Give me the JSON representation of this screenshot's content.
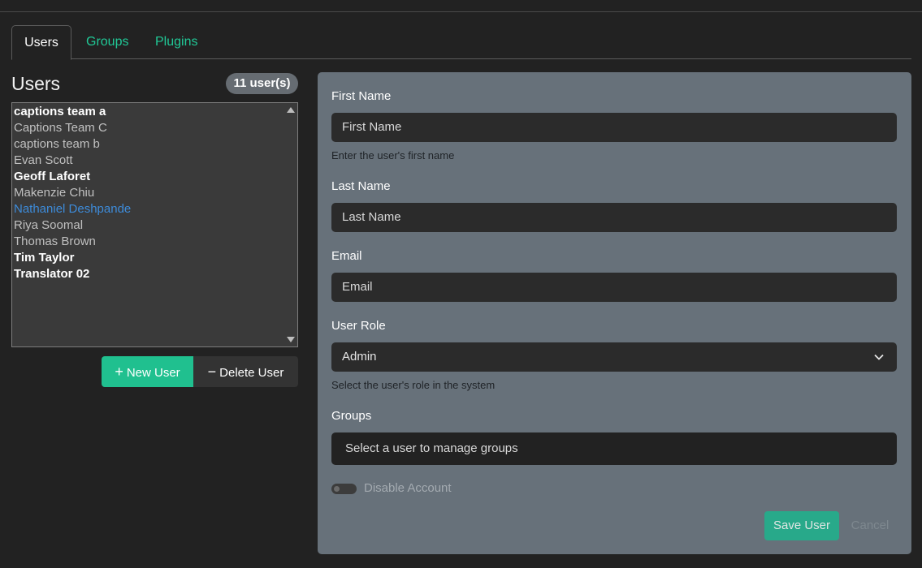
{
  "tabs": [
    {
      "label": "Users",
      "active": true
    },
    {
      "label": "Groups",
      "active": false
    },
    {
      "label": "Plugins",
      "active": false
    }
  ],
  "users_panel": {
    "title": "Users",
    "count_badge": "11 user(s)",
    "users": [
      {
        "name": "captions team a",
        "style": "bold"
      },
      {
        "name": "Captions Team C",
        "style": "normal"
      },
      {
        "name": "captions team b",
        "style": "normal"
      },
      {
        "name": "Evan Scott",
        "style": "normal"
      },
      {
        "name": "Geoff Laforet",
        "style": "bold"
      },
      {
        "name": "Makenzie Chiu",
        "style": "normal"
      },
      {
        "name": "Nathaniel Deshpande",
        "style": "selected"
      },
      {
        "name": "Riya Soomal",
        "style": "normal"
      },
      {
        "name": "Thomas Brown",
        "style": "normal"
      },
      {
        "name": "Tim Taylor",
        "style": "bold"
      },
      {
        "name": "Translator 02",
        "style": "bold"
      }
    ],
    "new_user_label": "New User",
    "delete_user_label": "Delete User"
  },
  "form": {
    "first_name": {
      "label": "First Name",
      "placeholder": "First Name",
      "hint": "Enter the user's first name"
    },
    "last_name": {
      "label": "Last Name",
      "placeholder": "Last Name"
    },
    "email": {
      "label": "Email",
      "placeholder": "Email"
    },
    "user_role": {
      "label": "User Role",
      "value": "Admin",
      "hint": "Select the user's role in the system"
    },
    "groups": {
      "label": "Groups",
      "placeholder": "Select a user to manage groups"
    },
    "disable_account": {
      "label": "Disable Account",
      "checked": false
    },
    "save_label": "Save User",
    "cancel_label": "Cancel"
  },
  "colors": {
    "accent": "#20c997",
    "selected_user": "#3d8bd9",
    "panel_bg": "#67717a"
  },
  "icons": {
    "new": "plus-icon",
    "delete": "minus-icon",
    "select": "chevron-down-icon"
  }
}
